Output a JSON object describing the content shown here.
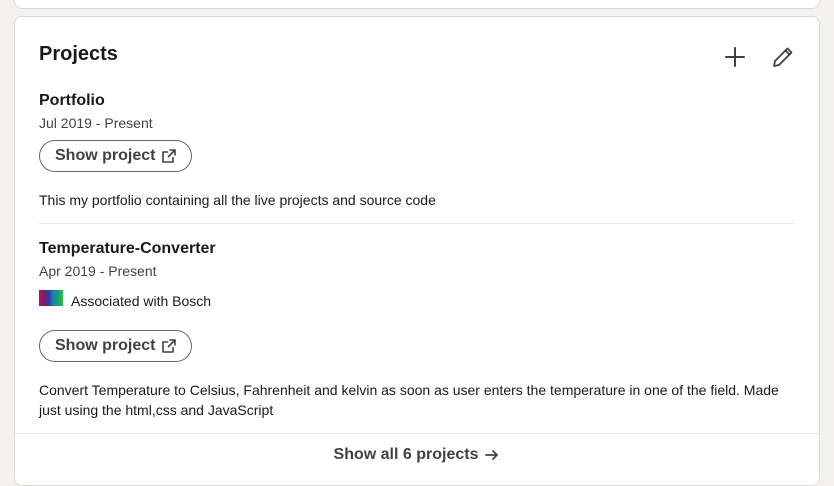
{
  "section": {
    "title": "Projects",
    "add_icon": "plus-icon",
    "edit_icon": "pencil-icon"
  },
  "projects": [
    {
      "title": "Portfolio",
      "date": "Jul 2019 - Present",
      "button_label": "Show project",
      "description": "This my portfolio containing all the live projects and source code"
    },
    {
      "title": "Temperature-Converter",
      "date": "Apr 2019 - Present",
      "association": "Associated with Bosch",
      "button_label": "Show project",
      "description": "Convert Temperature to Celsius, Fahrenheit and kelvin as soon as user enters the temperature in one of the field. Made just using the html,css and JavaScript"
    }
  ],
  "footer": {
    "show_all_label": "Show all 6 projects"
  }
}
